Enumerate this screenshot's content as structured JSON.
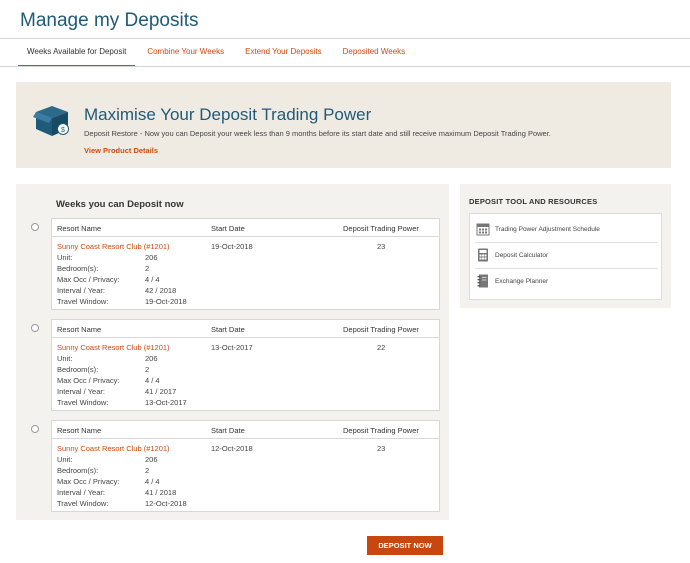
{
  "page": {
    "title": "Manage my Deposits"
  },
  "tabs": [
    {
      "label": "Weeks Available for Deposit",
      "active": true
    },
    {
      "label": "Combine Your Weeks"
    },
    {
      "label": "Extend Your Deposits"
    },
    {
      "label": "Deposited Weeks"
    }
  ],
  "promo": {
    "icon": "box-icon",
    "title": "Maximise Your Deposit Trading Power",
    "text": "Deposit Restore - Now you can Deposit your week less than 9 months before its start date and still receive maximum Deposit Trading Power.",
    "link": "View Product Details"
  },
  "weeks": {
    "heading": "Weeks you can Deposit now",
    "headers": {
      "resort": "Resort Name",
      "start": "Start Date",
      "power": "Deposit Trading Power"
    },
    "detail_labels": [
      "Unit:",
      "Bedroom(s):",
      "Max Occ / Privacy:",
      "Interval / Year:",
      "Travel Window:"
    ],
    "items": [
      {
        "resort": "Sunny Coast Resort Club (#1201)",
        "start_date": "19-Oct-2018",
        "power": "23",
        "unit": "206",
        "bedrooms": "2",
        "max_occ": "4 / 4",
        "interval": "42 / 2018",
        "travel_window": "19-Oct-2018"
      },
      {
        "resort": "Sunny Coast Resort Club (#1201)",
        "start_date": "13-Oct-2017",
        "power": "22",
        "unit": "206",
        "bedrooms": "2",
        "max_occ": "4 / 4",
        "interval": "41 / 2017",
        "travel_window": "13-Oct-2017"
      },
      {
        "resort": "Sunny Coast Resort Club (#1201)",
        "start_date": "12-Oct-2018",
        "power": "23",
        "unit": "206",
        "bedrooms": "2",
        "max_occ": "4 / 4",
        "interval": "41 / 2018",
        "travel_window": "12-Oct-2018"
      }
    ]
  },
  "resources": {
    "heading": "DEPOSIT TOOL AND RESOURCES",
    "items": [
      {
        "label": "Trading Power Adjustment Schedule",
        "icon": "calendar-icon"
      },
      {
        "label": "Deposit Calculator",
        "icon": "calculator-icon"
      },
      {
        "label": "Exchange Planner",
        "icon": "notebook-icon"
      }
    ]
  },
  "actions": {
    "deposit_now": "DEPOSIT NOW"
  },
  "colors": {
    "accent": "#d1490e",
    "title_blue": "#1f5a78",
    "promo_bg": "#efebe3",
    "panel_bg": "#f4f2ef"
  }
}
